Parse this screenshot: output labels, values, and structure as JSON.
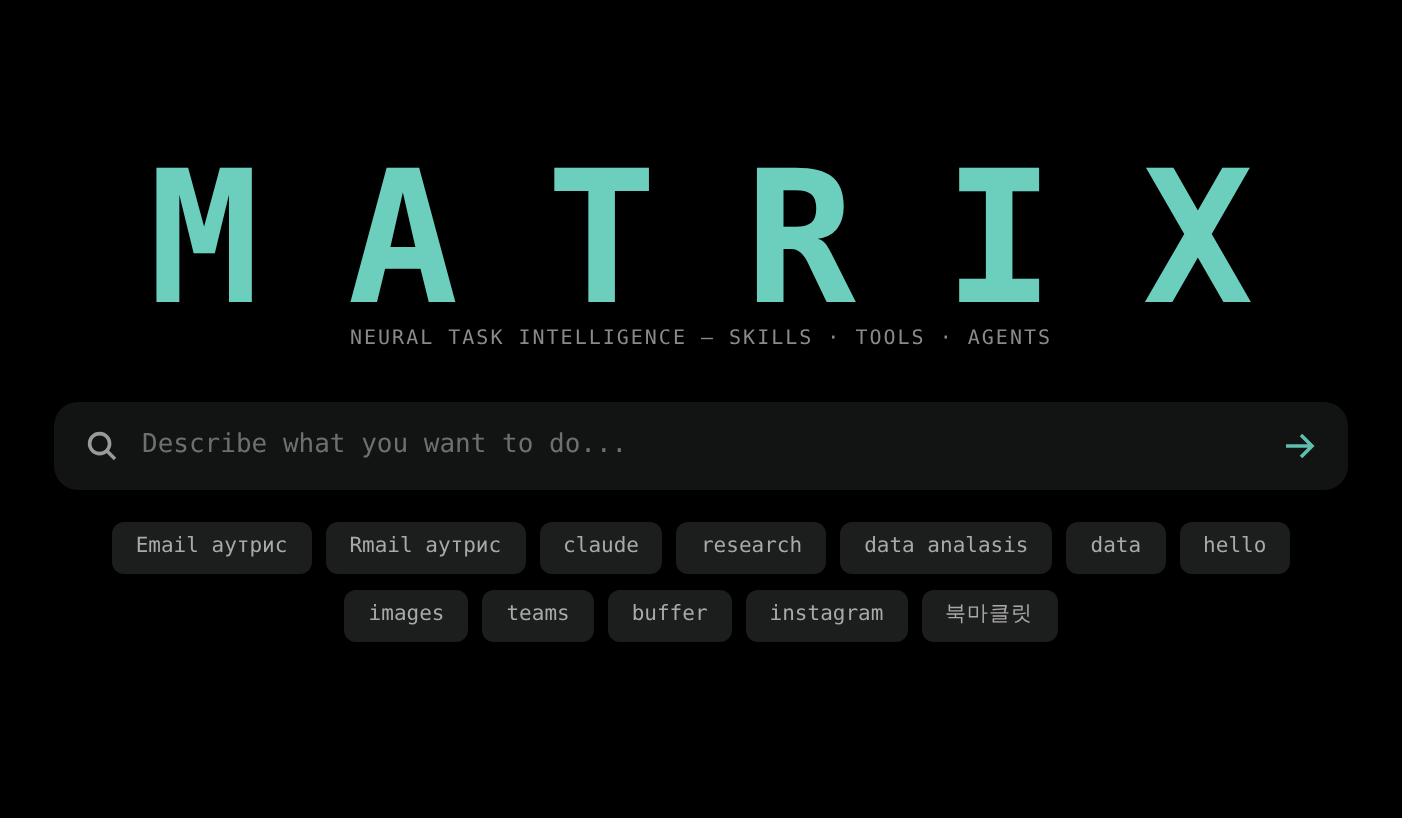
{
  "logo": "MATRIX",
  "tagline": "NEURAL TASK INTELLIGENCE — SKILLS · TOOLS · AGENTS",
  "search": {
    "placeholder": "Describe what you want to do..."
  },
  "tags": [
    {
      "label": "Email аутрис"
    },
    {
      "label": "Rmail аутрис"
    },
    {
      "label": "claude"
    },
    {
      "label": "research"
    },
    {
      "label": "data analasis"
    },
    {
      "label": "data"
    },
    {
      "label": "hello"
    },
    {
      "label": "images"
    },
    {
      "label": "teams"
    },
    {
      "label": "buffer"
    },
    {
      "label": "instagram"
    },
    {
      "label": "북마클릿"
    }
  ]
}
